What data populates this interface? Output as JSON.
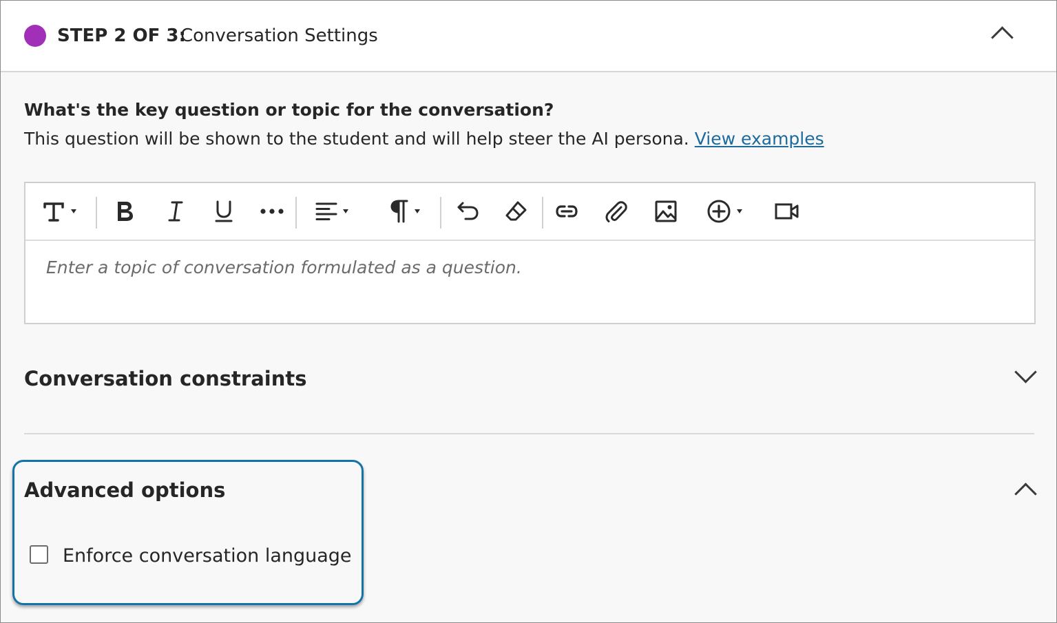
{
  "step": {
    "label": "STEP 2 OF 3:",
    "title": "Conversation Settings",
    "dot_color": "#a12fb8",
    "collapse_icon": "chevron-up-icon"
  },
  "topic": {
    "question": "What's the key question or topic for the conversation?",
    "helper": "This question will be shown to the student and will help steer the AI persona.",
    "link": "View examples",
    "placeholder": "Enter a topic of conversation formulated as a question."
  },
  "toolbar": {
    "buttons": [
      "text-style-icon",
      "bold-icon",
      "italic-icon",
      "underline-icon",
      "more-icon",
      "align-icon",
      "paragraph-icon",
      "undo-icon",
      "clear-format-icon",
      "link-icon",
      "attach-icon",
      "image-icon",
      "insert-icon",
      "video-icon"
    ]
  },
  "constraints": {
    "title": "Conversation constraints",
    "icon": "chevron-down-icon"
  },
  "advanced": {
    "title": "Advanced options",
    "icon": "chevron-up-icon",
    "checkbox_label": "Enforce conversation language",
    "checked": false
  },
  "colors": {
    "link": "#1c6b9c",
    "highlight": "#1373a6"
  }
}
